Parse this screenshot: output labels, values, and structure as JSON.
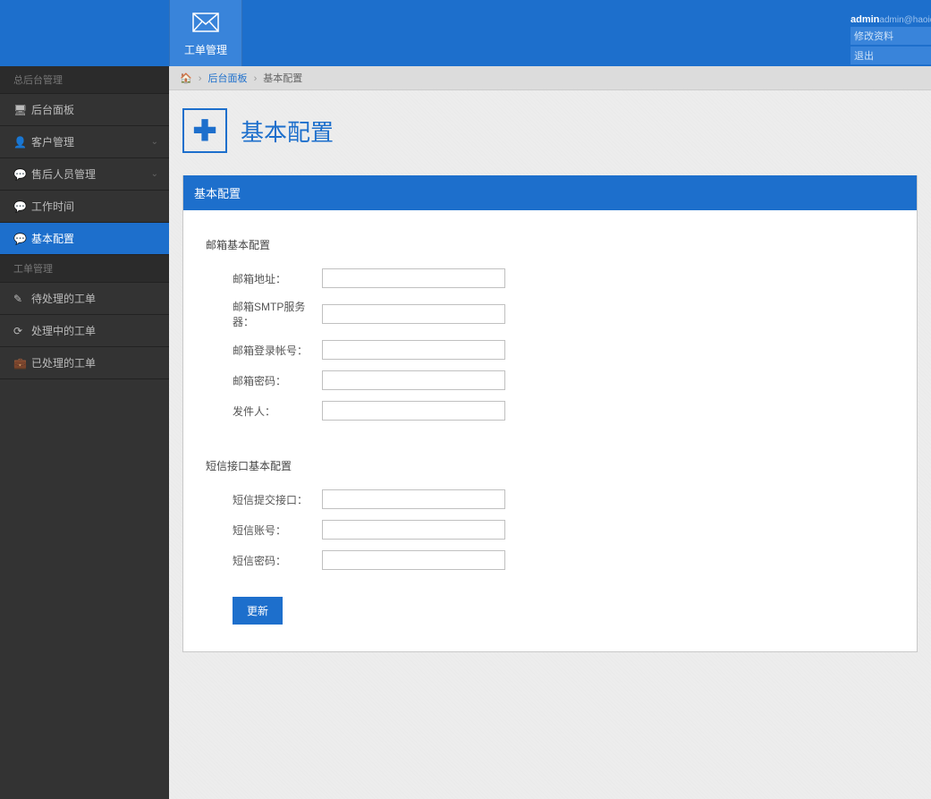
{
  "header": {
    "tab_label": "工单管理",
    "user_name": "admin",
    "user_email": "admin@haoid.cn",
    "link_profile": "修改资料",
    "link_logout": "退出"
  },
  "sidebar": {
    "section1_title": "总后台管理",
    "section2_title": "工单管理",
    "items1": [
      {
        "label": "后台面板",
        "icon": "laptop",
        "expandable": false,
        "active": false
      },
      {
        "label": "客户管理",
        "icon": "user",
        "expandable": true,
        "active": false
      },
      {
        "label": "售后人员管理",
        "icon": "comment",
        "expandable": true,
        "active": false
      },
      {
        "label": "工作时间",
        "icon": "comment",
        "expandable": false,
        "active": false
      },
      {
        "label": "基本配置",
        "icon": "comment",
        "expandable": false,
        "active": true
      }
    ],
    "items2": [
      {
        "label": "待处理的工单",
        "icon": "pencil"
      },
      {
        "label": "处理中的工单",
        "icon": "refresh"
      },
      {
        "label": "已处理的工单",
        "icon": "briefcase"
      }
    ]
  },
  "breadcrumb": {
    "link1": "后台面板",
    "current": "基本配置"
  },
  "page": {
    "title": "基本配置"
  },
  "card": {
    "header": "基本配置",
    "section1": {
      "title": "邮箱基本配置",
      "rows": [
        {
          "label": "邮箱地址：",
          "value": ""
        },
        {
          "label": "邮箱SMTP服务器：",
          "value": ""
        },
        {
          "label": "邮箱登录帐号：",
          "value": ""
        },
        {
          "label": "邮箱密码：",
          "value": ""
        },
        {
          "label": "发件人：",
          "value": ""
        }
      ]
    },
    "section2": {
      "title": "短信接口基本配置",
      "rows": [
        {
          "label": "短信提交接口：",
          "value": ""
        },
        {
          "label": "短信账号：",
          "value": ""
        },
        {
          "label": "短信密码：",
          "value": ""
        }
      ]
    },
    "submit_label": "更新"
  }
}
